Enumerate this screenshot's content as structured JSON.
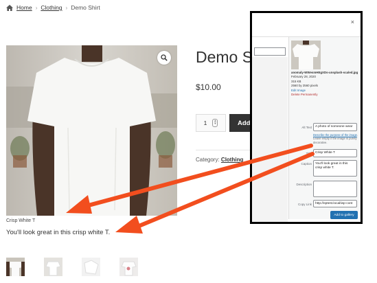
{
  "breadcrumb": {
    "home": "Home",
    "category": "Clothing",
    "current": "Demo Shirt"
  },
  "product": {
    "title": "Demo Shirt",
    "price": "$10.00",
    "quantity": "1",
    "add_to_cart": "Add",
    "category_label": "Category:",
    "category_value": "Clothing",
    "image_caption": "Crisp White T",
    "description": "You'll look great in this crisp white T."
  },
  "media_modal": {
    "close": "×",
    "file": {
      "filename": "anomaly-WWesmHEgXDs-unsplash-scaled.jpg",
      "date": "February 28, 2020",
      "size": "315 KB",
      "dimensions": "2560 by 2560 pixels",
      "edit": "Edit Image",
      "delete": "Delete Permanently"
    },
    "alt_label": "Alt Text",
    "alt_value": "A photo of someone wear",
    "alt_help_link": "Describe the purpose of the image",
    "alt_help_text": ". Leave empty if the image is purely decorative.",
    "title_label": "Title",
    "title_value": "Crisp White T",
    "caption_label": "Caption",
    "caption_value": "You'll look great in this crisp white T.",
    "description_label": "Description",
    "description_value": "",
    "copy_label": "Copy Link",
    "copy_value": "http://eptest.local/wp-cont",
    "add_button": "Add to gallery"
  },
  "colors": {
    "arrow": "#f24e1e",
    "button_blue": "#2271b1",
    "link_blue": "#2271b1",
    "delete_red": "#b32d2e"
  }
}
